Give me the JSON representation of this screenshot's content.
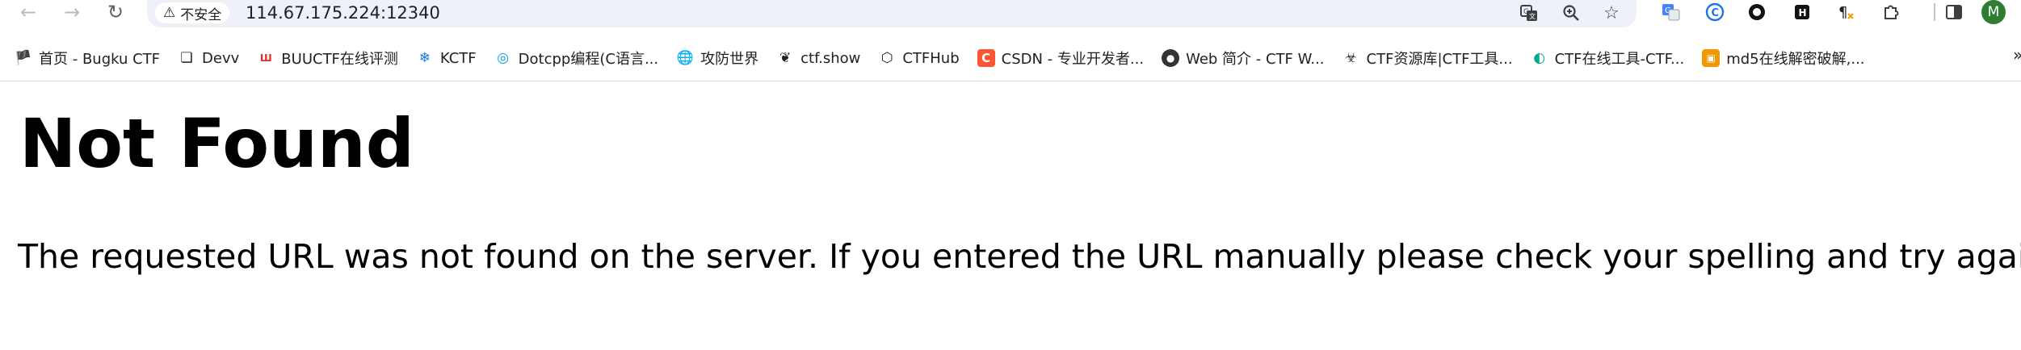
{
  "browser": {
    "security_label": "不安全",
    "url": "114.67.175.224:12340",
    "avatar_letter": "M",
    "icons": {
      "back": "arrow-left-icon",
      "forward": "arrow-right-icon",
      "reload": "reload-icon",
      "security": "warning-triangle-icon",
      "translate": "translate-icon",
      "zoom": "zoom-icon",
      "bookmark_star": "star-icon"
    }
  },
  "bookmarks": [
    {
      "label": "首页 - Bugku CTF",
      "icon": "flag-icon"
    },
    {
      "label": "Devv",
      "icon": "cube-icon"
    },
    {
      "label": "BUUCTF在线评测",
      "icon": "buu-icon"
    },
    {
      "label": "KCTF",
      "icon": "snowflake-icon"
    },
    {
      "label": "Dotcpp编程(C语言...",
      "icon": "dotcpp-icon"
    },
    {
      "label": "攻防世界",
      "icon": "globe-icon"
    },
    {
      "label": "ctf.show",
      "icon": "runner-icon"
    },
    {
      "label": "CTFHub",
      "icon": "hub-icon"
    },
    {
      "label": "CSDN - 专业开发者...",
      "icon": "csdn-icon"
    },
    {
      "label": "Web 简介 - CTF W...",
      "icon": "web-icon"
    },
    {
      "label": "CTF资源库|CTF工具...",
      "icon": "spy-icon"
    },
    {
      "label": "CTF在线工具-CTF...",
      "icon": "ctf-tools-icon"
    },
    {
      "label": "md5在线解密破解,...",
      "icon": "md5-icon"
    }
  ],
  "page": {
    "title": "Not Found",
    "message": "The requested URL was not found on the server. If you entered the URL manually please check your spelling and try again."
  }
}
